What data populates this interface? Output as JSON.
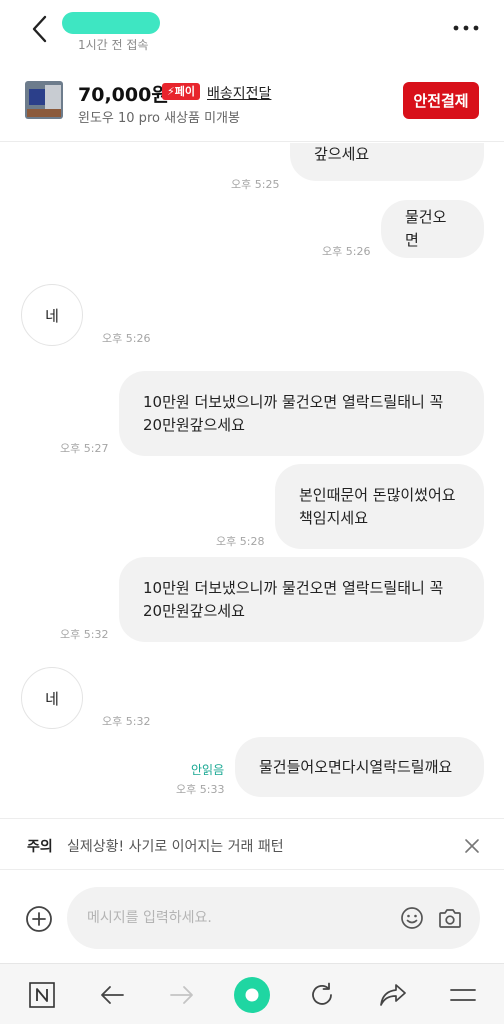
{
  "header": {
    "last_seen": "1시간 전 접속"
  },
  "product": {
    "price": "70,000원",
    "pay_badge": "⚡페이",
    "delivery_label": "배송지전달",
    "title": "윈도우 10 pro 새상품 미개봉",
    "safe_pay_label": "안전결제"
  },
  "messages": [
    {
      "side": "sent",
      "text": "갚으세요",
      "time": "오후 5:25"
    },
    {
      "side": "sent",
      "text": "물건오면",
      "time": "오후 5:26"
    },
    {
      "side": "received",
      "text": "네",
      "time": "오후 5:26"
    },
    {
      "side": "sent",
      "text": "10만원 더보냈으니까 물건오면 열락드릴태니 꼭 20만원갚으세요",
      "time": "오후 5:27"
    },
    {
      "side": "sent",
      "text": "본인때문어 돈많이썼어요 책임지세요",
      "time": "오후 5:28"
    },
    {
      "side": "sent",
      "text": "10만원 더보냈으니까 물건오면 열락드릴태니 꼭 20만원갚으세요",
      "time": "오후 5:32"
    },
    {
      "side": "received",
      "text": "네",
      "time": "오후 5:32"
    },
    {
      "side": "sent",
      "text": "물건들어오면다시열락드릴깨요",
      "time": "오후 5:33",
      "status": "안읽음"
    }
  ],
  "warning": {
    "label": "주의",
    "text": "실제상황! 사기로 이어지는 거래 패턴"
  },
  "composer": {
    "placeholder": "메시지를 입력하세요."
  },
  "icons": {
    "back": "chevron-left-icon",
    "more": "more-horizontal-icon",
    "close": "close-icon",
    "add": "plus-circle-icon",
    "emoji": "smile-icon",
    "camera": "camera-icon",
    "home": "naver-n-icon",
    "nav_back": "arrow-left-icon",
    "nav_forward": "arrow-right-icon",
    "green_dot": "green-dot-icon",
    "refresh": "refresh-icon",
    "share": "share-icon",
    "menu": "menu-icon"
  },
  "colors": {
    "accent_red": "#d8101a",
    "mint": "#3ee6c2",
    "unread_green": "#19a893",
    "bubble_gray": "#f2f2f2"
  }
}
